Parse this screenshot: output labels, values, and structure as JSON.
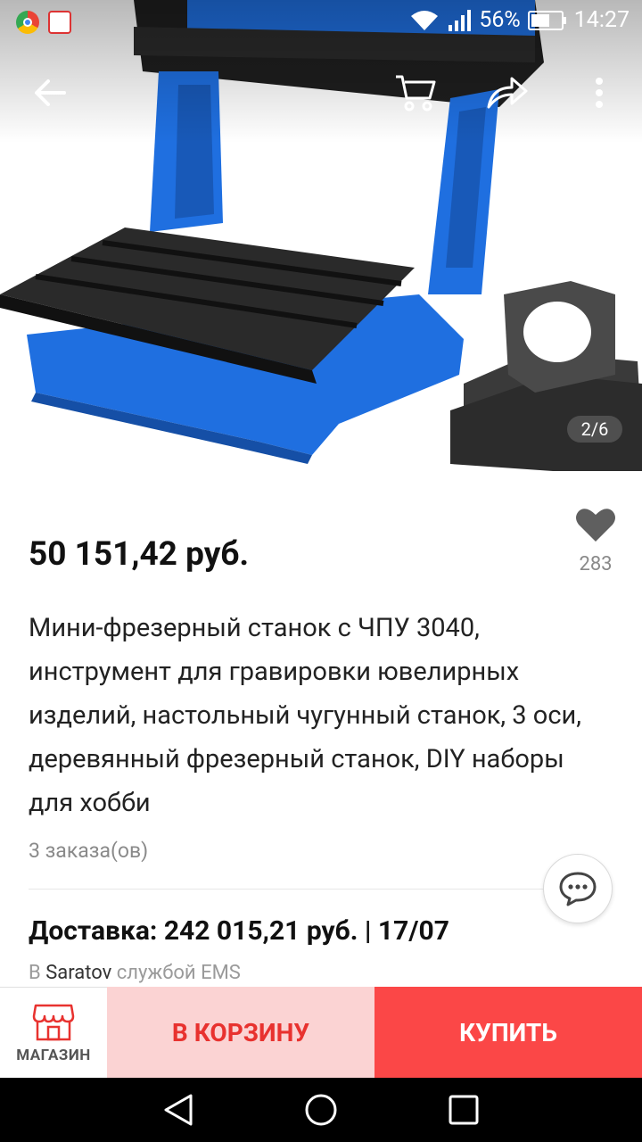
{
  "status_bar": {
    "battery": "56%",
    "time": "14:27",
    "left_icons": [
      "chrome-icon",
      "app-logo-icon"
    ],
    "right_icons": [
      "wifi-icon",
      "signal-icon",
      "battery-icon"
    ]
  },
  "toolbar": {
    "icons": [
      "back-arrow-icon",
      "cart-icon",
      "share-icon",
      "more-icon"
    ]
  },
  "gallery": {
    "pager": "2/6"
  },
  "product": {
    "price": "50 151,42 руб.",
    "wishlist_count": "283",
    "title": "Мини-фрезерный станок с ЧПУ 3040, инструмент для гравировки ювелирных изделий, настольный чугунный станок, 3 оси, деревянный фрезерный станок, DIY наборы для хобби",
    "orders": "3 заказа(ов)"
  },
  "shipping": {
    "line": "Доставка: 242 015,21 руб. | 17/07",
    "prefix": "В",
    "city": "Saratov",
    "suffix": "службой EMS"
  },
  "actions": {
    "store_label": "МАГАЗИН",
    "cart_label": "В КОРЗИНУ",
    "buy_label": "КУПИТЬ"
  },
  "colors": {
    "buy": "#fb4747",
    "cart_bg": "#fbd3d3",
    "cart_text": "#e8322f",
    "machine_blue": "#1f6fe0"
  }
}
